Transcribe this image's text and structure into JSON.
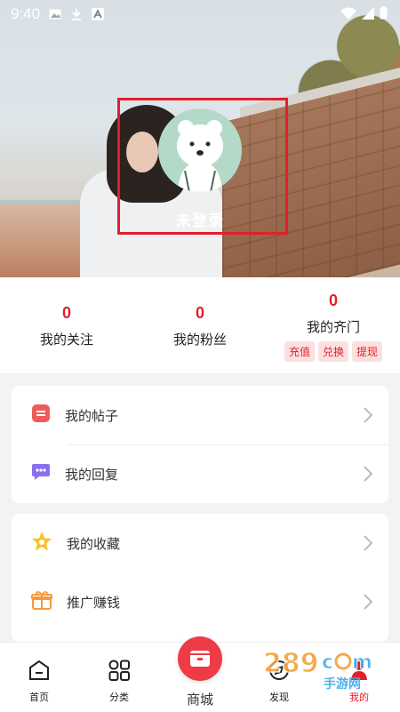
{
  "status": {
    "time": "9:40"
  },
  "profile": {
    "login_status": "未登录"
  },
  "stats": [
    {
      "count": "0",
      "label": "我的关注"
    },
    {
      "count": "0",
      "label": "我的粉丝"
    },
    {
      "count": "0",
      "label": "我的齐门",
      "actions": [
        "充值",
        "兑换",
        "提现"
      ]
    }
  ],
  "menu_groups": [
    [
      {
        "label": "我的帖子",
        "icon": "post-icon"
      },
      {
        "label": "我的回复",
        "icon": "reply-icon"
      }
    ],
    [
      {
        "label": "我的收藏",
        "icon": "star-icon"
      },
      {
        "label": "推广赚钱",
        "icon": "gift-icon"
      }
    ]
  ],
  "tabbar": {
    "items": [
      "首页",
      "分类",
      "商城",
      "发现",
      "我的"
    ],
    "active": "我的"
  },
  "watermark": {
    "brand": "289.com",
    "sub": "手游网"
  },
  "colors": {
    "accent": "#e21f2a",
    "avatar_bg": "#b3dac8"
  }
}
